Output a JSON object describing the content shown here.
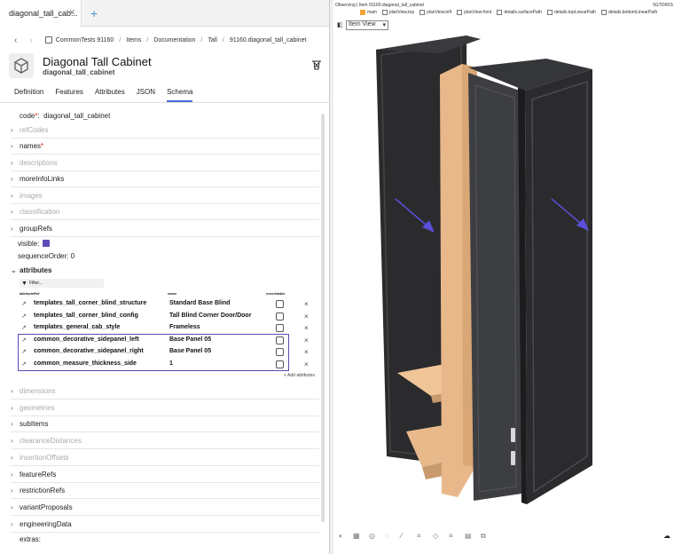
{
  "tab": {
    "label": "diagonal_tall_cab..."
  },
  "breadcrumb": [
    "CommonTests 91160",
    "Items",
    "Documentation",
    "Tall",
    "91160.diagonal_tall_cabinet"
  ],
  "header": {
    "title": "Diagonal Tall Cabinet",
    "subtitle": "diagonal_tall_cabinet"
  },
  "subtabs": [
    "Definition",
    "Features",
    "Attributes",
    "JSON",
    "Schema"
  ],
  "code": {
    "label": "code",
    "value": "diagonal_tall_cabinet"
  },
  "props_top": [
    "refCodes",
    "names",
    "descriptions",
    "moreInfoLinks",
    "images",
    "classification",
    "groupRefs"
  ],
  "visible_label": "visible:",
  "sequence": {
    "label": "sequenceOrder:",
    "value": "0"
  },
  "attributes_label": "attributes",
  "filter_placeholder": "Filter...",
  "attr_headers": {
    "ref": "attributeRef",
    "value": "value",
    "overridable": "overridable"
  },
  "attr_rows": [
    {
      "ref": "templates_tall_corner_blind_structure",
      "value": "Standard Base Blind"
    },
    {
      "ref": "templates_tall_corner_blind_config",
      "value": "Tall Blind Corner Door/Door"
    },
    {
      "ref": "templates_general_cab_style",
      "value": "Frameless"
    },
    {
      "ref": "common_decorative_sidepanel_left",
      "value": "Base Panel 05"
    },
    {
      "ref": "common_decorative_sidepanel_right",
      "value": "Base Panel 05"
    },
    {
      "ref": "common_measure_thickness_side",
      "value": "1"
    }
  ],
  "add_attributes": "+ Add attributes",
  "props_bottom": [
    "dimensions",
    "geometries",
    "subItems",
    "clearanceDistances",
    "insertionOffsets",
    "featureRefs",
    "restrictionRefs",
    "variantProposals",
    "engineeringData"
  ],
  "extras_label": "extras:",
  "viewer": {
    "observing": "Observing | Item 91160.diagonal_tall_cabinet",
    "build": "5GTD6KS",
    "views": [
      "main",
      "planView.top",
      "planView.left",
      "planView.front",
      "details.surfacePath",
      "details.topLinearPath",
      "details.bottomLinearPath"
    ],
    "mode": "Item View"
  },
  "colors": {
    "accent": "#5b4db5",
    "cabinet_dark": "#2b2b2e",
    "cabinet_wood": "#e8b88a",
    "arrow": "#5a4fd8"
  }
}
